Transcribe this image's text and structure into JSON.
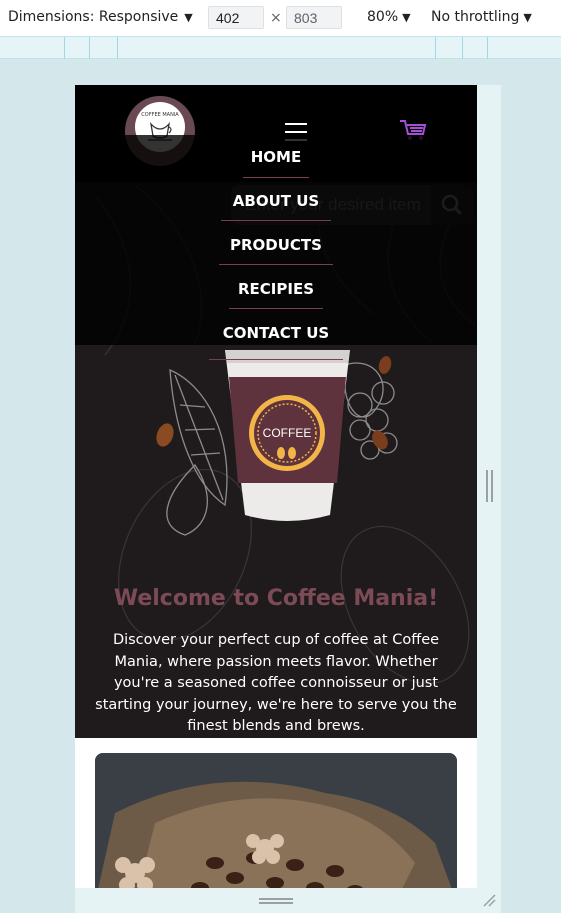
{
  "devtools": {
    "dimensions_label": "Dimensions: Responsive",
    "caret": "▼",
    "width_value": "402",
    "height_value": "803",
    "times": "×",
    "zoom_label": "80%",
    "throttle_label": "No throttling"
  },
  "site": {
    "logo_text": "COFFEE MANIA",
    "hamburger_icon": "hamburger-icon",
    "cart_icon": "shopping-cart-icon",
    "search_placeholder": "Enter your desired item",
    "search_icon": "search-icon",
    "nav": {
      "items": [
        {
          "label": "HOME"
        },
        {
          "label": "ABOUT US"
        },
        {
          "label": "PRODUCTS"
        },
        {
          "label": "RECIPIES"
        },
        {
          "label": "CONTACT US"
        }
      ]
    },
    "cup_label": "COFFEE",
    "hero_title": "Welcome to Coffee Mania!",
    "hero_text": "Discover your perfect cup of coffee at Coffee Mania, where passion meets flavor. Whether you're a seasoned coffee connoisseur or just starting your journey, we're here to serve you the finest blends and brews."
  },
  "colors": {
    "accent_maroon": "#7c4b56",
    "nav_divider": "#7a3e4c",
    "cart_purple": "#a64fd6",
    "hero_bg": "#1f1b1c"
  }
}
